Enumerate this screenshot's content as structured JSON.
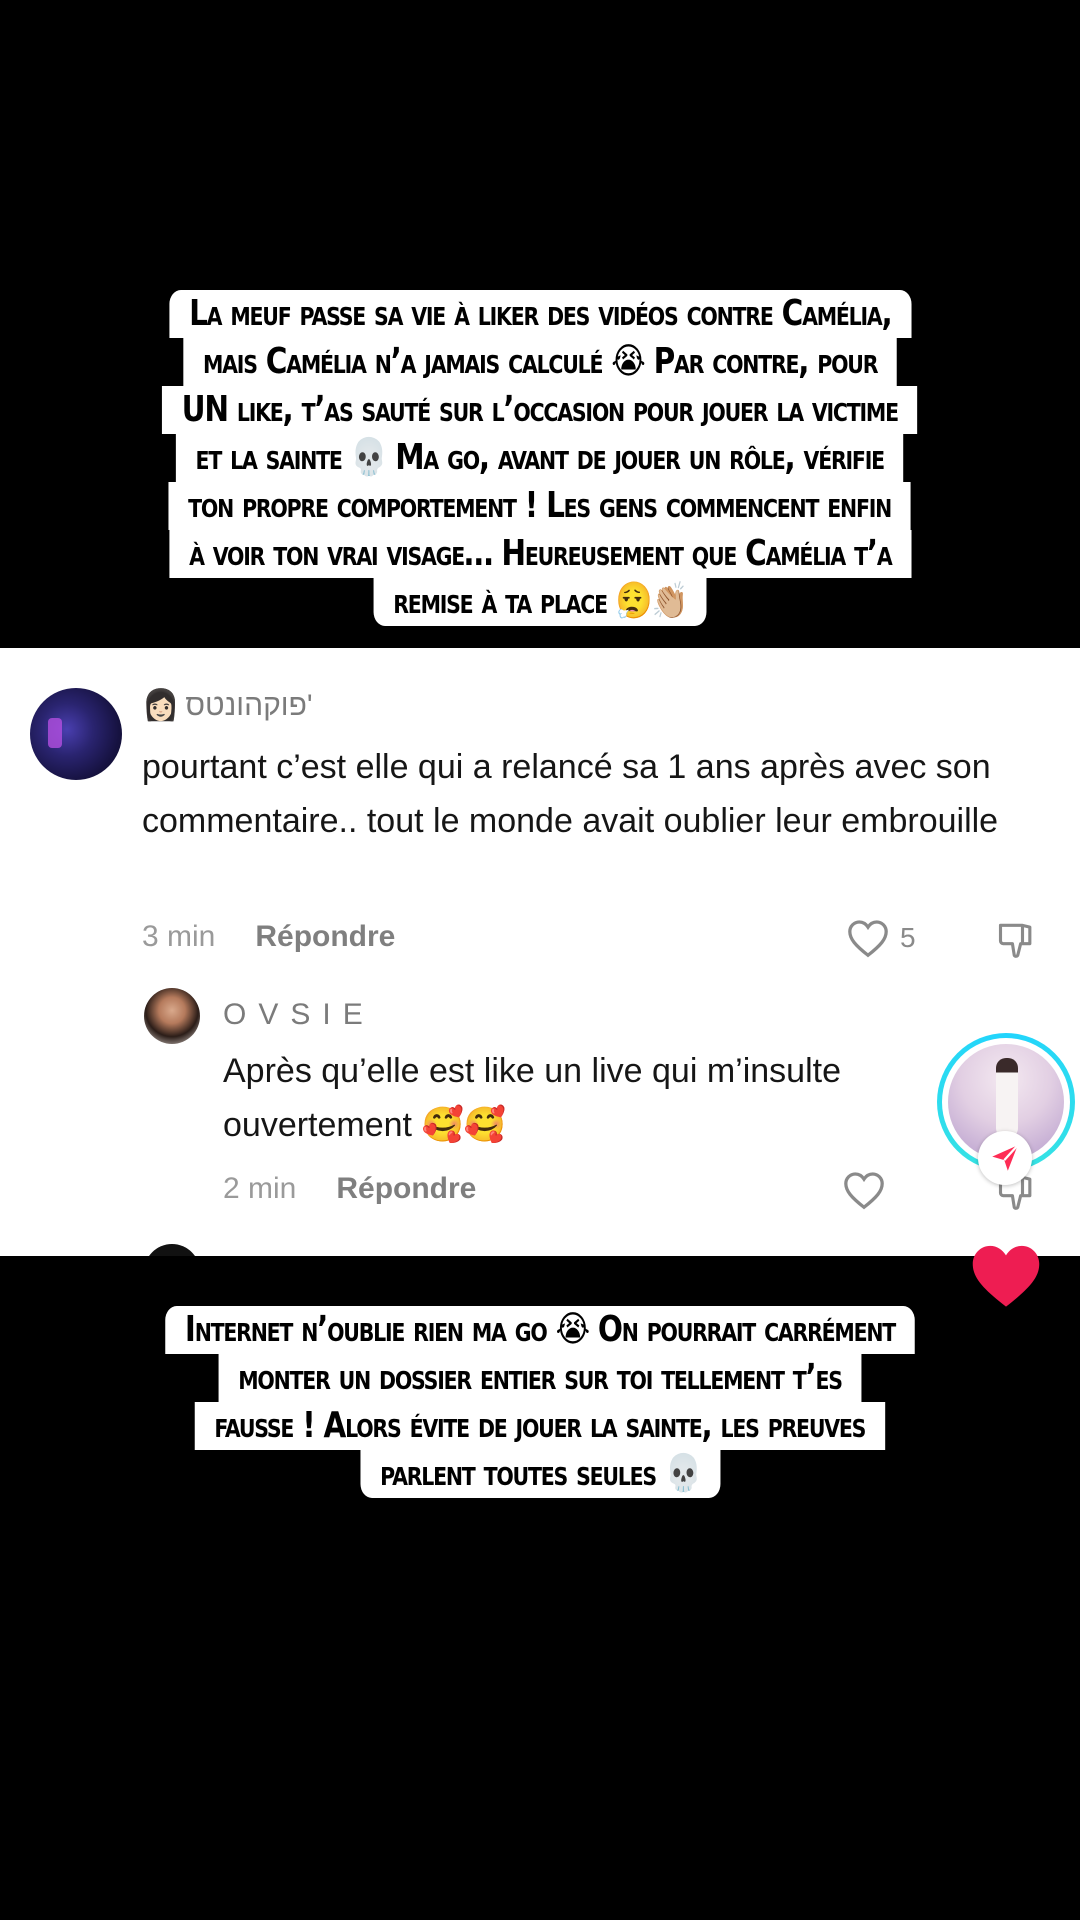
{
  "caption_top": {
    "lines": [
      "La meuf passe sa vie à liker des vidéos contre Camélia,",
      "mais Camélia n’a jamais calculé 😭 Par contre, pour",
      "UN like, t’as sauté sur l’occasion pour jouer la victime",
      "et la sainte 💀 Ma go, avant de jouer un rôle, vérifie",
      "ton propre comportement ! Les gens commencent enfin",
      "à voir ton vrai visage… Heureusement que Camélia t’a",
      "remise à ta place 😮‍💨👏🏼"
    ]
  },
  "comments": [
    {
      "username": "פוקהונטס'",
      "username_emoji": "👩🏻",
      "text": "pourtant c’est elle qui a relancé sa 1 ans après avec son commentaire.. tout le monde avait oublier leur embrouille",
      "time": "3 min",
      "reply_label": "Répondre",
      "likes": "5"
    },
    {
      "username": "OVSIE",
      "text": "Après qu’elle est like un live qui m’insulte ouvertement 🥰🥰",
      "time": "2 min",
      "reply_label": "Répondre",
      "likes": ""
    }
  ],
  "caption_bottom": {
    "lines": [
      "Internet n’oublie rien ma go 😭 On pourrait carrément",
      "monter un dossier entier sur toi tellement t’es",
      "fausse ! Alors évite de jouer la sainte, les preuves",
      "parlent toutes seules 💀"
    ]
  },
  "colors": {
    "background": "#000000",
    "caption_bg": "#ffffff",
    "heart": "#ee1d52",
    "share": "#fe2c55",
    "ring": "#21d4fd"
  },
  "icons": {
    "like": "heart-outline-icon",
    "dislike": "thumbs-down-icon",
    "share": "send-arrow-icon",
    "overlay_like": "heart-filled-icon"
  }
}
